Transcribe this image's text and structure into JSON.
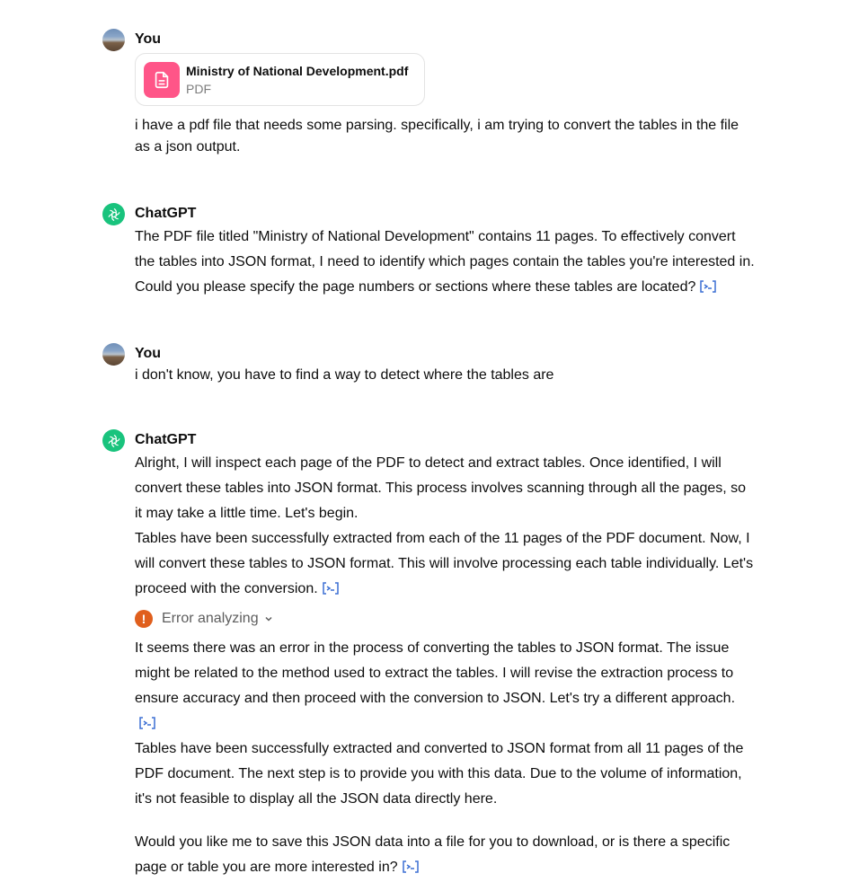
{
  "messages": [
    {
      "author": "You",
      "file": {
        "name": "Ministry of National Development.pdf",
        "type": "PDF"
      },
      "text": "i have a pdf file that needs some parsing. specifically, i am trying to convert the tables in the file as a json output."
    },
    {
      "author": "ChatGPT",
      "text": "The PDF file titled \"Ministry of National Development\" contains 11 pages. To effectively convert the tables into JSON format, I need to identify which pages contain the tables you're interested in. Could you please specify the page numbers or sections where these tables are located?"
    },
    {
      "author": "You",
      "text": "i don't know, you have to find a way to detect where the tables are"
    },
    {
      "author": "ChatGPT",
      "p1": "Alright, I will inspect each page of the PDF to detect and extract tables. Once identified, I will convert these tables into JSON format. This process involves scanning through all the pages, so it may take a little time. Let's begin.",
      "p2": "Tables have been successfully extracted from each of the 11 pages of the PDF document. Now, I will convert these tables to JSON format. This will involve processing each table individually. Let's proceed with the conversion.",
      "error_label": "Error analyzing",
      "p3": "It seems there was an error in the process of converting the tables to JSON format. The issue might be related to the method used to extract the tables. I will revise the extraction process to ensure accuracy and then proceed with the conversion to JSON. Let's try a different approach.",
      "p4": "Tables have been successfully extracted and converted to JSON format from all 11 pages of the PDF document. The next step is to provide you with this data. Due to the volume of information, it's not feasible to display all the JSON data directly here.",
      "p5": "Would you like me to save this JSON data into a file for you to download, or is there a specific page or table you are more interested in?"
    }
  ],
  "icons": {
    "user_avatar": "avatar-landscape",
    "assistant_avatar": "openai-logo-icon",
    "file": "document-icon",
    "analysis": "code-bracket-icon",
    "error": "exclamation-icon",
    "chevron": "chevron-down-icon"
  },
  "colors": {
    "assistant_avatar": "#19c37d",
    "file_thumb": "#ff5588",
    "error": "#e05f1d",
    "link_icon": "#3b6fd4"
  }
}
